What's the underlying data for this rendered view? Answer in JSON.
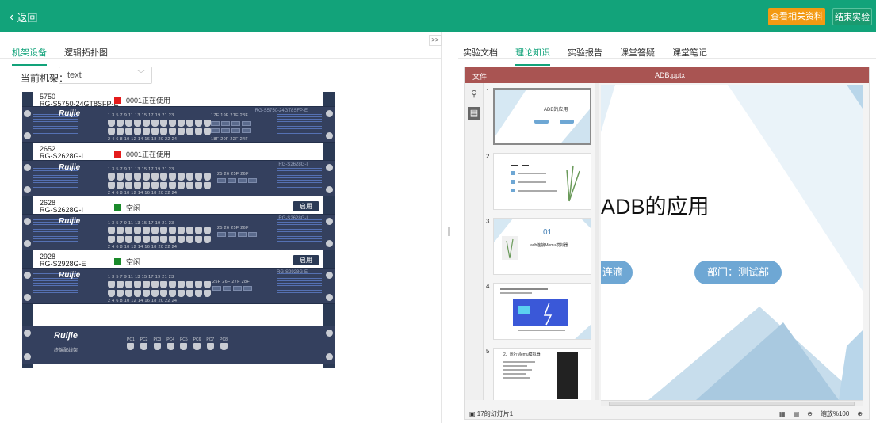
{
  "topbar": {
    "back_label": "返回",
    "btn_related": "查看相关资料",
    "btn_end": "结束实验",
    "bg": "#12a37a",
    "orange": "#f39a12"
  },
  "left": {
    "tabs": [
      {
        "label": "机架设备",
        "active": true
      },
      {
        "label": "逻辑拓扑图",
        "active": false
      }
    ],
    "rack_label": "当前机架：",
    "rack_value": "text",
    "slots": [
      {
        "name": "5750",
        "model": "RG-S5750-24GT8SFP-E",
        "status": "0001正在使用",
        "status_color": "#e41b1b",
        "device_model": "RG-S5750-24GT8SFP-E",
        "apply": ""
      },
      {
        "name": "2652",
        "model": "RG-S2628G-I",
        "status": "0001正在使用",
        "status_color": "#e41b1b",
        "device_model": "RG-S2628G-I",
        "apply": ""
      },
      {
        "name": "2628",
        "model": "RG-S2628G-I",
        "status": "空闲",
        "status_color": "#1a8a2a",
        "device_model": "RG-S2628G-I",
        "apply": "启用"
      },
      {
        "name": "2928",
        "model": "RG-S2928G-E",
        "status": "空闲",
        "status_color": "#1a8a2a",
        "device_model": "RG-S2928G-E",
        "apply": "启用"
      }
    ],
    "brand": "Ruijie",
    "top_nums": "1  3  5  7  9  11   13  15  17  19  21  23",
    "bottom_nums": "2  4  6  8  10  12   14  16  18  20  22  24",
    "sfp_top_0": "17F  19F  21F  23F",
    "sfp_bottom_0": "18F  20F  22F  24F",
    "sfp_top_1": "25  26  25F  26F",
    "sfp_top_3": "25F  26F  27F  28F",
    "patch_panel": {
      "brand": "Ruijie",
      "subtitle": "终端配线架",
      "ports": [
        "PC1",
        "PC2",
        "PC3",
        "PC4",
        "PC5",
        "PC6",
        "PC7",
        "PC8"
      ]
    }
  },
  "collapse_label": ">>",
  "right": {
    "tabs": [
      {
        "label": "实验文档",
        "active": false
      },
      {
        "label": "理论知识",
        "active": true
      },
      {
        "label": "实验报告",
        "active": false
      },
      {
        "label": "课堂答疑",
        "active": false
      },
      {
        "label": "课堂笔记",
        "active": false
      }
    ],
    "viewer": {
      "file_label": "文件",
      "file_name": "ADB.pptx",
      "thumb_numbers": [
        "1",
        "2",
        "3",
        "4",
        "5"
      ],
      "thumb1_title": "ADB的应用",
      "thumb3_num": "01",
      "thumb3_text": "adb连接Memu模拟器",
      "thumb5_title": "2、运行Memu模拟器",
      "slide_title": "ADB的应用",
      "pill_left": "连滴",
      "pill_right": "部门：测试部",
      "status_left": "17的幻灯片1",
      "zoom_label": "缩放%100",
      "header_color": "#a95452"
    }
  }
}
